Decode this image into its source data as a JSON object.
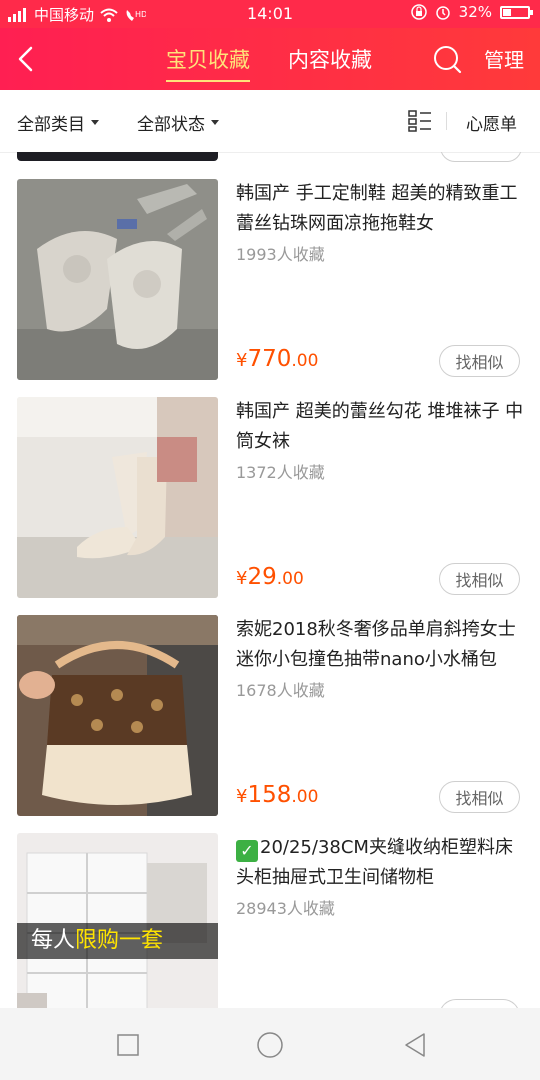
{
  "status_bar": {
    "carrier": "中国移动",
    "time": "14:01",
    "battery": "32%",
    "battery_level": 0.32
  },
  "header": {
    "tabs": [
      {
        "label": "宝贝收藏",
        "active": true
      },
      {
        "label": "内容收藏",
        "active": false
      }
    ],
    "manage_label": "管理"
  },
  "filters": {
    "category_label": "全部类目",
    "status_label": "全部状态",
    "wishlist_label": "心愿单"
  },
  "items": [
    {
      "title": "韩国产 手工定制鞋 超美的精致重工蕾丝钻珠网面凉拖拖鞋女",
      "favorites": "1993人收藏",
      "price_symbol": "¥",
      "price_int": "770",
      "price_dec": ".00",
      "similar_label": "找相似"
    },
    {
      "title": "韩国产 超美的蕾丝勾花 堆堆袜子 中筒女袜",
      "favorites": "1372人收藏",
      "price_symbol": "¥",
      "price_int": "29",
      "price_dec": ".00",
      "similar_label": "找相似"
    },
    {
      "title": "索妮2018秋冬奢侈品单肩斜挎女士迷你小包撞色抽带nano小水桶包",
      "favorites": "1678人收藏",
      "price_symbol": "¥",
      "price_int": "158",
      "price_dec": ".00",
      "similar_label": "找相似"
    },
    {
      "title": "20/25/38CM夹缝收纳柜塑料床头柜抽屉式卫生间储物柜",
      "check_mark": "✓",
      "favorites": "28943人收藏",
      "banner_prefix": "每人",
      "banner_highlight": "限购一套"
    }
  ],
  "colors": {
    "accent": "#ff2a4a",
    "price": "#ff5000",
    "active_tab": "#ffe27a"
  }
}
